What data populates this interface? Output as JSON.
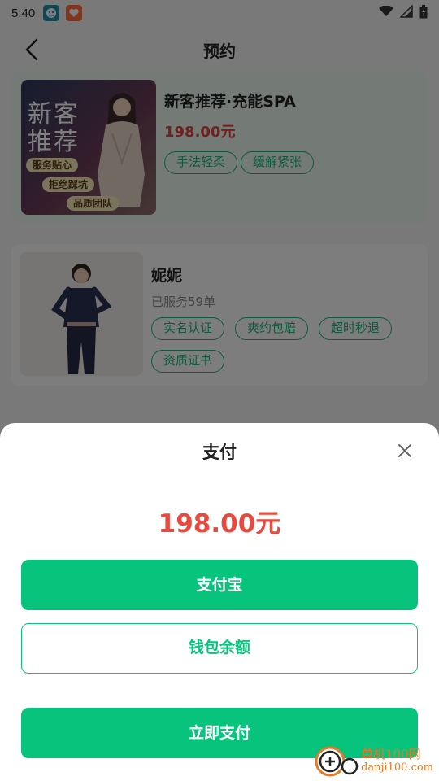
{
  "status_bar": {
    "time": "5:40"
  },
  "header": {
    "title": "预约"
  },
  "service": {
    "title": "新客推荐·充能SPA",
    "price": "198.00元",
    "tags": [
      "手法轻柔",
      "缓解紧张"
    ],
    "thumbnail": {
      "headline_line1": "新客",
      "headline_line2": "推荐",
      "tags": [
        "服务贴心",
        "拒绝踩坑",
        "品质团队"
      ]
    }
  },
  "staff": {
    "name": "妮妮",
    "served": "已服务59单",
    "tags": [
      "实名认证",
      "爽约包赔",
      "超时秒退",
      "资质证书"
    ]
  },
  "payment_sheet": {
    "title": "支付",
    "amount": "198.00元",
    "options": [
      "支付宝",
      "钱包余额"
    ],
    "submit_label": "立即支付"
  },
  "watermark": {
    "title": "单机100网",
    "url": "danji100.com"
  },
  "colors": {
    "accent": "#07c37c",
    "price_red": "#e84a3f",
    "tag_green": "#20b37a",
    "card_highlight": "#e8f6ee"
  }
}
